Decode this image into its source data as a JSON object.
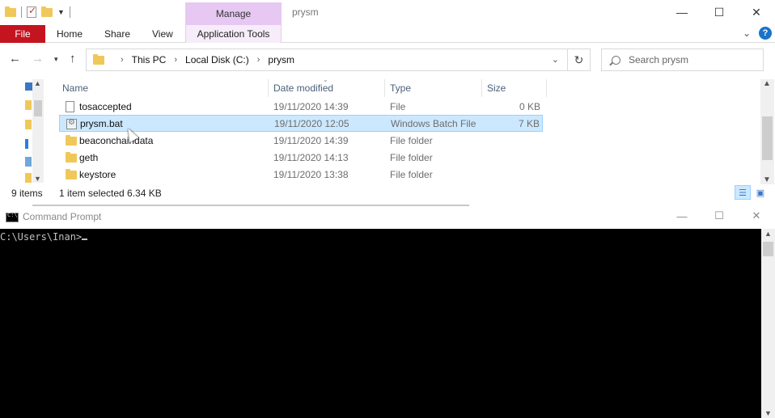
{
  "explorer": {
    "title": "prysm",
    "manage_label": "Manage",
    "ribbon_tabs": [
      "File",
      "Home",
      "Share",
      "View",
      "Application Tools"
    ],
    "window_controls": {
      "minimize": "—",
      "maximize": "☐",
      "close": "✕"
    },
    "help": "?",
    "breadcrumb": [
      "This PC",
      "Local Disk (C:)",
      "prysm"
    ],
    "search_placeholder": "Search prysm",
    "columns": {
      "name": "Name",
      "date": "Date modified",
      "type": "Type",
      "size": "Size"
    },
    "files": [
      {
        "name": "tosaccepted",
        "date": "19/11/2020 14:39",
        "type": "File",
        "size": "0 KB",
        "icon": "file-icon",
        "selected": false
      },
      {
        "name": "prysm.bat",
        "date": "19/11/2020 12:05",
        "type": "Windows Batch File",
        "size": "7 KB",
        "icon": "batch-file-icon",
        "selected": true
      },
      {
        "name": "beaconchaindata",
        "date": "19/11/2020 14:39",
        "type": "File folder",
        "size": "",
        "icon": "folder-icon",
        "selected": false
      },
      {
        "name": "geth",
        "date": "19/11/2020 14:13",
        "type": "File folder",
        "size": "",
        "icon": "folder-icon",
        "selected": false
      },
      {
        "name": "keystore",
        "date": "19/11/2020 13:38",
        "type": "File folder",
        "size": "",
        "icon": "folder-icon",
        "selected": false
      }
    ],
    "status": {
      "count": "9 items",
      "selection": "1 item selected  6.34 KB"
    }
  },
  "cmd": {
    "title": "Command Prompt",
    "prompt": "C:\\Users\\Inan>"
  },
  "colors": {
    "file_tab": "#c4141f",
    "manage_tab": "#e6c8f3",
    "selection": "#cce8ff",
    "console_bg": "#000000",
    "console_text": "#c0c0c0"
  }
}
